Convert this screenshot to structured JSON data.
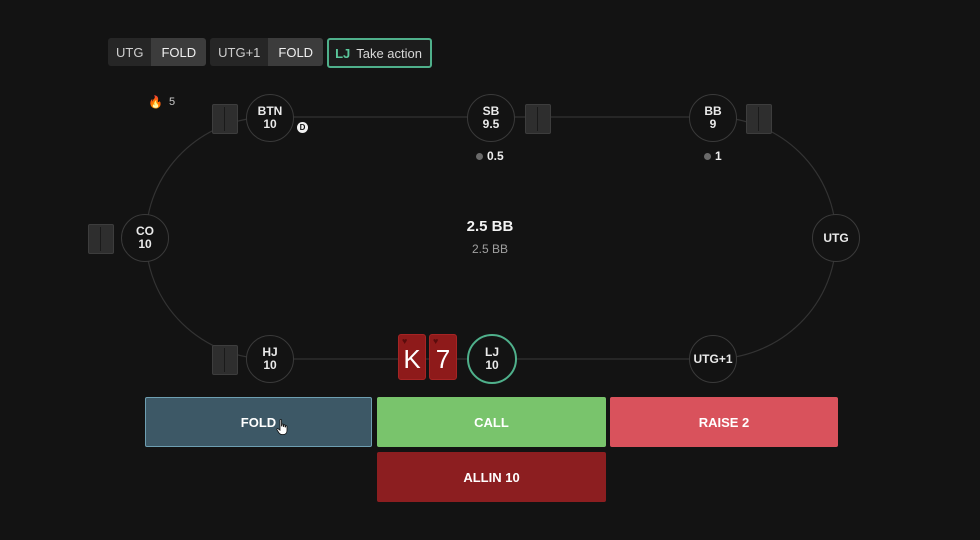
{
  "history": [
    {
      "position": "UTG",
      "action": "FOLD"
    },
    {
      "position": "UTG+1",
      "action": "FOLD"
    },
    {
      "position": "LJ",
      "action": "Take action"
    }
  ],
  "streak": {
    "icon": "flame-icon",
    "count": "5"
  },
  "seats": {
    "btn": {
      "name": "BTN",
      "stack": "10"
    },
    "sb": {
      "name": "SB",
      "stack": "9.5"
    },
    "bb": {
      "name": "BB",
      "stack": "9"
    },
    "co": {
      "name": "CO",
      "stack": "10"
    },
    "utg": {
      "name": "UTG",
      "stack": ""
    },
    "hj": {
      "name": "HJ",
      "stack": "10"
    },
    "lj": {
      "name": "LJ",
      "stack": "10"
    },
    "utg1": {
      "name": "UTG+1",
      "stack": ""
    }
  },
  "dealer_button": "D",
  "bets": {
    "sb": "0.5",
    "bb": "1"
  },
  "pot": {
    "main": "2.5 BB",
    "sub": "2.5 BB"
  },
  "hero_cards": [
    {
      "rank": "K",
      "suit": "♥"
    },
    {
      "rank": "7",
      "suit": "♥"
    }
  ],
  "actions": {
    "fold": "FOLD",
    "call": "CALL",
    "raise": "RAISE 2",
    "allin": "ALLIN 10"
  },
  "colors": {
    "background": "#131313",
    "hero_accent": "#4fb08b",
    "fold": "#3d5866",
    "call": "#79c46c",
    "raise": "#d9525c",
    "allin": "#8c1e20",
    "card": "#8e1a1a"
  }
}
